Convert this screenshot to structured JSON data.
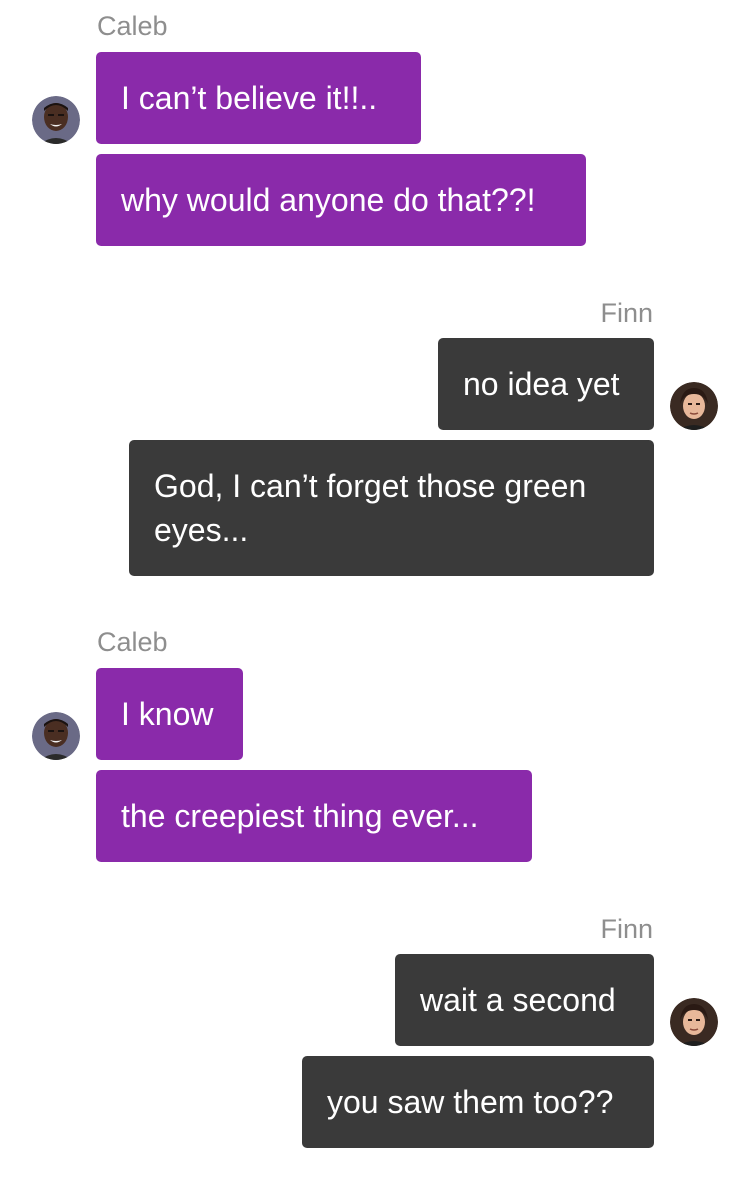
{
  "colors": {
    "caleb_bubble": "#8a2aaa",
    "finn_bubble": "#3a3a3a",
    "sender_label": "#8e8e8e",
    "background": "#ffffff"
  },
  "groups": [
    {
      "sender": "Caleb",
      "avatar_icon": "caleb-avatar-icon",
      "messages": [
        "I can’t believe it!!..",
        "why would anyone do that??!"
      ]
    },
    {
      "sender": "Finn",
      "avatar_icon": "finn-avatar-icon",
      "messages": [
        "no idea yet",
        "God, I can’t forget those green eyes..."
      ]
    },
    {
      "sender": "Caleb",
      "avatar_icon": "caleb-avatar-icon",
      "messages": [
        "I know",
        "the creepiest thing ever..."
      ]
    },
    {
      "sender": "Finn",
      "avatar_icon": "finn-avatar-icon",
      "messages": [
        "wait a second",
        "you saw them too??"
      ]
    }
  ]
}
